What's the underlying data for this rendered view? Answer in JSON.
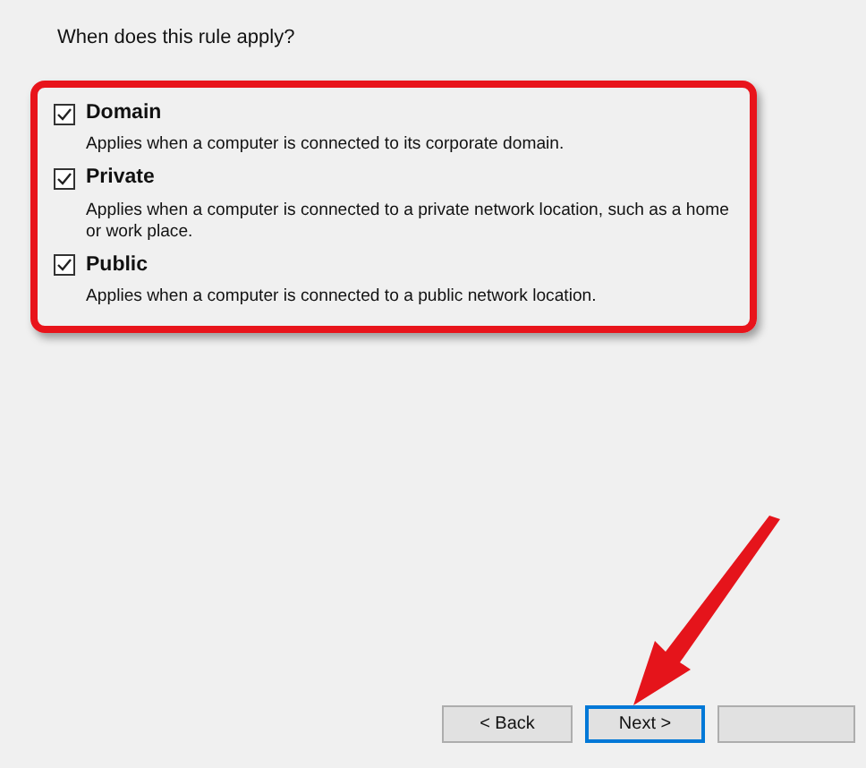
{
  "prompt": "When does this rule apply?",
  "profiles": [
    {
      "label": "Domain",
      "checked": true,
      "description": "Applies when a computer is connected to its corporate domain."
    },
    {
      "label": "Private",
      "checked": true,
      "description": "Applies when a computer is connected to a private network location, such as a home or work place."
    },
    {
      "label": "Public",
      "checked": true,
      "description": "Applies when a computer is connected to a public network location."
    }
  ],
  "buttons": [
    {
      "label": "< Back",
      "selected": false
    },
    {
      "label": "Next >",
      "selected": true
    },
    {
      "selected": false
    }
  ]
}
